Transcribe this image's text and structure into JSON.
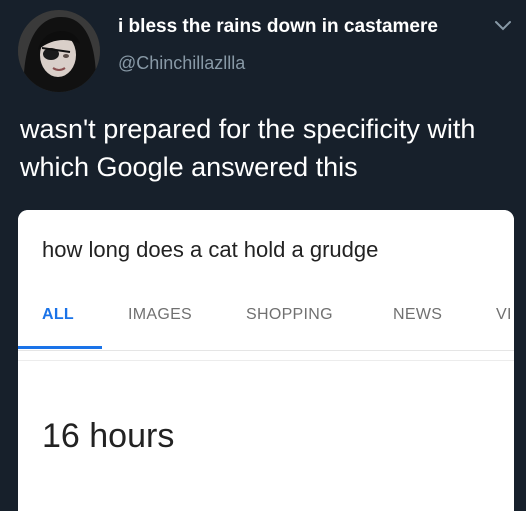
{
  "tweet": {
    "display_name": "i bless the rains down in castamere",
    "handle": "@Chinchillazllla",
    "text": "wasn't prepared for the specificity with which Google answered this",
    "menu_icon": "chevron-down-icon"
  },
  "search": {
    "query": "how long does a cat hold a grudge",
    "tabs": [
      {
        "label": "ALL",
        "active": true
      },
      {
        "label": "IMAGES",
        "active": false
      },
      {
        "label": "SHOPPING",
        "active": false
      },
      {
        "label": "NEWS",
        "active": false
      },
      {
        "label": "VI",
        "active": false
      }
    ],
    "answer": "16 hours",
    "accent_color": "#1a73e8"
  }
}
